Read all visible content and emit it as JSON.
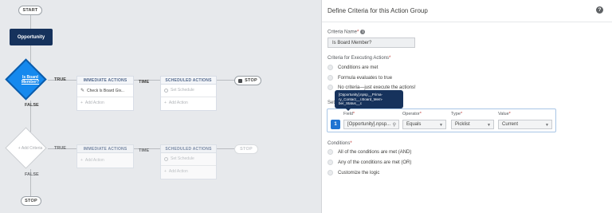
{
  "flow": {
    "start_label": "START",
    "object_label": "Opportunity",
    "decision1": {
      "label_line1": "Is Board",
      "label_line2": "Member?",
      "true_label": "TRUE",
      "false_label": "FALSE"
    },
    "decision2": {
      "label": "Add Criteria",
      "true_label": "TRUE",
      "false_label": "FALSE"
    },
    "time_label": "TIME",
    "immediate_header": "IMMEDIATE ACTIONS",
    "scheduled_header": "SCHEDULED ACTIONS",
    "action1": "Check Is Board Giv...",
    "add_action": "Add Action",
    "set_schedule": "Set Schedule",
    "stop_label": "STOP"
  },
  "panel": {
    "title": "Define Criteria for this Action Group",
    "help_icon": "?",
    "criteria_name_label": "Criteria Name",
    "criteria_name_value": "Is Board Member?",
    "exec_label": "Criteria for Executing Actions",
    "exec_options": [
      "Conditions are met",
      "Formula evaluates to true",
      "No criteria—just execute the actions!"
    ],
    "set_label_partial": "Set",
    "tooltip": {
      "line1": "[Opportunity].npsp__Prima-",
      "line2": "ry_Contact__r.Board_Mem-",
      "line3": "ber_Status__c"
    },
    "columns": {
      "field": "Field",
      "operator": "Operator",
      "type": "Type",
      "value": "Value"
    },
    "row": {
      "number": "1",
      "field": "[Opportunity].npsp...",
      "operator": "Equals",
      "type": "Picklist",
      "value": "Current"
    },
    "conditions_label": "Conditions",
    "conditions_options": [
      "All of the conditions are met (AND)",
      "Any of the conditions are met (OR)",
      "Customize the logic"
    ]
  }
}
